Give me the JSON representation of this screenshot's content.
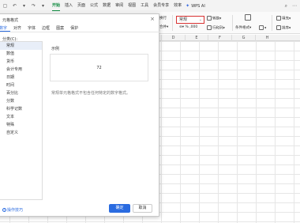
{
  "quick_access": {
    "icons": [
      "save-icon",
      "undo-icon",
      "undo-more-icon",
      "redo-icon",
      "redo-more-icon"
    ]
  },
  "menubar": {
    "items": [
      {
        "label": "开始",
        "active": true
      },
      {
        "label": "插入"
      },
      {
        "label": "页面"
      },
      {
        "label": "公式"
      },
      {
        "label": "数据"
      },
      {
        "label": "审阅"
      },
      {
        "label": "视图"
      },
      {
        "label": "工具"
      },
      {
        "label": "会员专享"
      },
      {
        "label": "效率"
      }
    ],
    "wps_ai": "WPS AI",
    "accent_color": "#0f8a3f"
  },
  "ribbon": {
    "wrap_label": "换行",
    "merge_label": "合并",
    "format_value": "常规",
    "convert_label": "转换",
    "rowcol_label": "行和列",
    "cond_format_label": "条件格式",
    "fill_label": "填充",
    "sort_label": "排序"
  },
  "columns": [
    "D",
    "E",
    "F",
    "G",
    "H"
  ],
  "dialog": {
    "title": "元格格式",
    "tabs": [
      "数字",
      "对齐",
      "字体",
      "边框",
      "图案",
      "保护"
    ],
    "active_tab": "数字",
    "category_label": "分类(C):",
    "categories": [
      "常规",
      "数值",
      "货币",
      "会计专用",
      "日期",
      "时间",
      "百分比",
      "分数",
      "科学记数",
      "文本",
      "特殊",
      "自定义"
    ],
    "selected_category": "常规",
    "sample_label": "示例",
    "sample_value": "72",
    "description": "常规单元格格式不包含任何特定的数字格式。",
    "tips_label": "操作技巧",
    "ok_label": "确定",
    "cancel_label": "取消",
    "accent_color": "#2a6be0"
  }
}
